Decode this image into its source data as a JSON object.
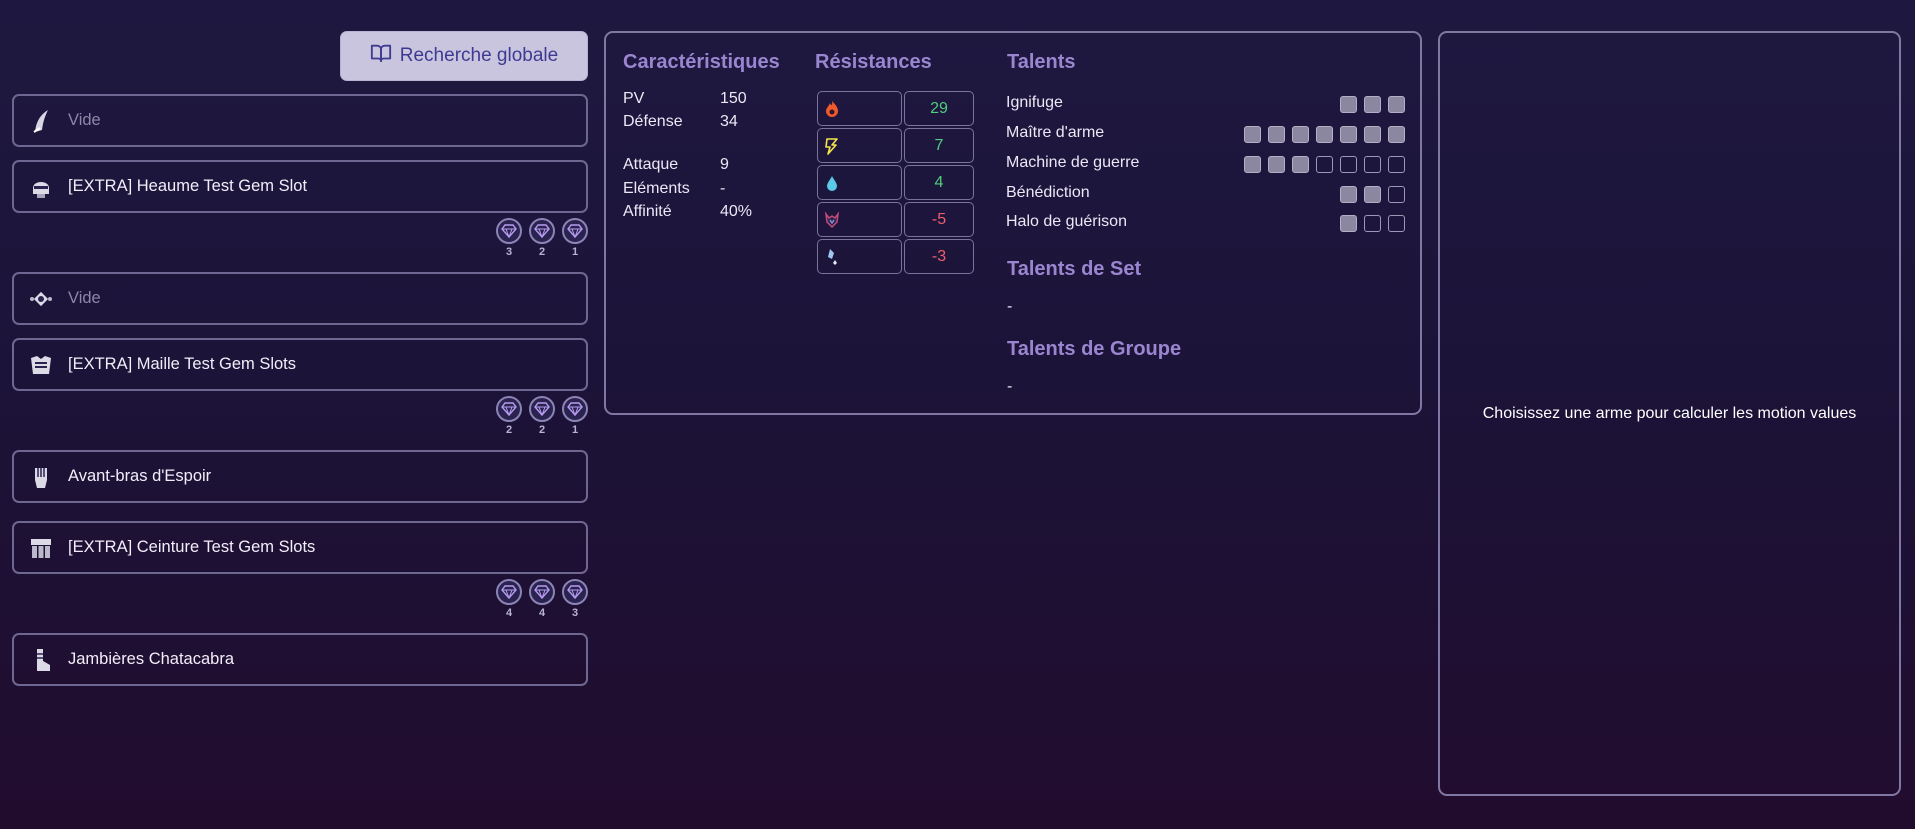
{
  "search_button": {
    "label": "Recherche globale",
    "icon": "book-open-icon"
  },
  "equipment": [
    {
      "icon": "weapon-blade-icon",
      "label": "Vide",
      "empty": true
    },
    {
      "icon": "helm-icon",
      "label": "[EXTRA] Heaume Test Gem Slot",
      "empty": false,
      "gems": [
        "3",
        "2",
        "1"
      ]
    },
    {
      "icon": "talisman-icon",
      "label": "Vide",
      "empty": true
    },
    {
      "icon": "chest-mail-icon",
      "label": "[EXTRA] Maille Test Gem Slots",
      "empty": false,
      "gems": [
        "2",
        "2",
        "1"
      ]
    },
    {
      "icon": "gauntlet-icon",
      "label": "Avant-bras d'Espoir",
      "empty": false
    },
    {
      "icon": "belt-icon",
      "label": "[EXTRA] Ceinture Test Gem Slots",
      "empty": false,
      "gems": [
        "4",
        "4",
        "3"
      ]
    },
    {
      "icon": "greaves-icon",
      "label": "Jambières Chatacabra",
      "empty": false
    }
  ],
  "characteristics": {
    "title": "Caractéristiques",
    "rows": [
      {
        "label": "PV",
        "value": "150"
      },
      {
        "label": "Défense",
        "value": "34"
      },
      {
        "label": "Attaque",
        "value": "9"
      },
      {
        "label": "Eléments",
        "value": "-"
      },
      {
        "label": "Affinité",
        "value": "40%"
      }
    ]
  },
  "resistances": {
    "title": "Résistances",
    "rows": [
      {
        "icon": "fire-icon",
        "color": "#f05a2a",
        "value": "29"
      },
      {
        "icon": "thunder-icon",
        "color": "#f3e64a",
        "value": "7"
      },
      {
        "icon": "water-icon",
        "color": "#5cc9e8",
        "value": "4"
      },
      {
        "icon": "dragon-icon",
        "color": "#c44a7a",
        "value": "-5"
      },
      {
        "icon": "ice-icon",
        "color": "#9fc7f0",
        "value": "-3"
      }
    ]
  },
  "talents": {
    "title": "Talents",
    "rows": [
      {
        "label": "Ignifuge",
        "level": 3,
        "max": 3
      },
      {
        "label": "Maître d'arme",
        "level": 7,
        "max": 7
      },
      {
        "label": "Machine de guerre",
        "level": 3,
        "max": 7
      },
      {
        "label": "Bénédiction",
        "level": 2,
        "max": 3
      },
      {
        "label": "Halo de guérison",
        "level": 1,
        "max": 3
      }
    ],
    "set_title": "Talents de Set",
    "set_value": "-",
    "group_title": "Talents de Groupe",
    "group_value": "-"
  },
  "motion_panel": {
    "message": "Choisissez une arme pour calculer les motion values"
  },
  "colors": {
    "accent": "#9a86d0",
    "positive": "#4fce7c",
    "negative": "#ee5f6a"
  }
}
